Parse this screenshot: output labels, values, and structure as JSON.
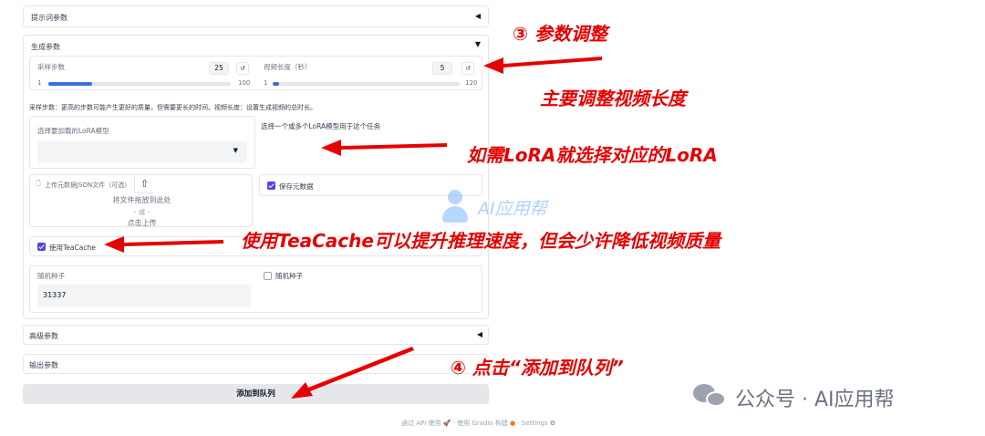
{
  "accordions": {
    "prompt_params": "提示词参数",
    "gen_params": "生成参数",
    "advanced_params": "高级参数",
    "output_params": "输出参数"
  },
  "sampling": {
    "label": "采样步数",
    "value": "25",
    "min": "1",
    "max": "100",
    "fraction": 0.24
  },
  "video_length": {
    "label": "视频长度（秒）",
    "value": "5",
    "min": "1",
    "max": "120",
    "fraction": 0.034
  },
  "help_text": "采样步数：更高的步数可能产生更好的质量，但需要更长的时间。视频长度：设置生成视频的总时长。",
  "lora": {
    "label": "选择要加载的LoRA模型",
    "info": "选择一个或多个LoRA模型用于这个任务"
  },
  "upload": {
    "label": "上传元数据JSON文件（可选）",
    "drop": "将文件拖放到此处",
    "or": "- 或 -",
    "click": "点击上传"
  },
  "save_metadata": "保存元数据",
  "teacache": "使用TeaCache",
  "seed": {
    "label": "随机种子",
    "value": "31337"
  },
  "random_seed": "随机种子",
  "submit": "添加到队列",
  "footer": {
    "api": "通过 API 使用",
    "gradio": "使用 Gradio 构建",
    "settings": "Settings"
  },
  "annotations": {
    "a1": "③ 参数调整",
    "a2": "主要调整视频长度",
    "a3": "如需LoRA就选择对应的LoRA",
    "a4": "使用TeaCache可以提升推理速度，但会少许降低视频质量",
    "a5": "④ 点击“添加到队列”"
  },
  "watermark": {
    "center": "AI应用帮",
    "bottom": "公众号 · AI应用帮"
  },
  "colors": {
    "annotation": "#e60000",
    "accent": "#4f46e5",
    "slider": "#3b6fe0"
  }
}
